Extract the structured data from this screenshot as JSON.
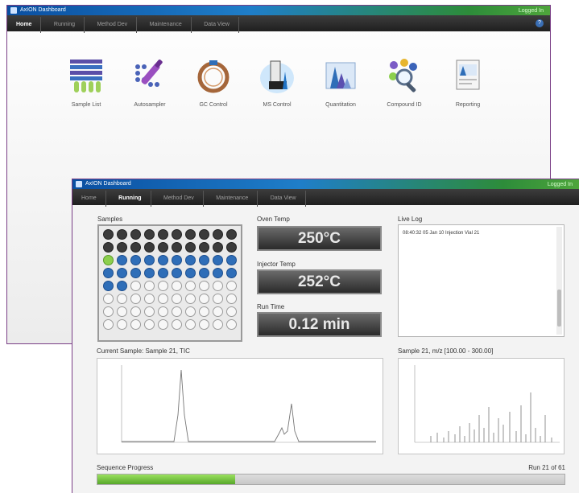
{
  "window_home": {
    "title": "AxION Dashboard",
    "status": "Logged In",
    "nav_tabs": [
      "Home",
      "Running",
      "Method Dev",
      "Maintenance",
      "Data View"
    ],
    "active_tab": "Home",
    "launchers": [
      {
        "label": "Sample List",
        "icon": "sample-list-icon"
      },
      {
        "label": "Autosampler",
        "icon": "autosampler-icon"
      },
      {
        "label": "GC Control",
        "icon": "gc-control-icon"
      },
      {
        "label": "MS Control",
        "icon": "ms-control-icon"
      },
      {
        "label": "Quantitation",
        "icon": "quantitation-icon"
      },
      {
        "label": "Compound ID",
        "icon": "compound-id-icon"
      },
      {
        "label": "Reporting",
        "icon": "reporting-icon"
      }
    ]
  },
  "window_running": {
    "title": "AxION Dashboard",
    "status": "Logged In",
    "nav_tabs": [
      "Home",
      "Running",
      "Method Dev",
      "Maintenance",
      "Data View"
    ],
    "active_tab": "Running",
    "samples": {
      "label": "Samples",
      "rows": 8,
      "cols": 10,
      "completed": 20,
      "current_index": 21,
      "queued_until": 42
    },
    "oven_temp": {
      "label": "Oven Temp",
      "value": "250°C"
    },
    "injector_temp": {
      "label": "Injector Temp",
      "value": "252°C"
    },
    "run_time": {
      "label": "Run Time",
      "value": "0.12 min"
    },
    "live_log": {
      "label": "Live Log",
      "entries": [
        "08:40:32  05 Jan 10   Injection  Vial 21"
      ]
    },
    "tic_plot": {
      "label": "Current Sample: Sample 21, TIC"
    },
    "mz_plot": {
      "label": "Sample 21, m/z [100.00 - 300.00]"
    },
    "sequence": {
      "label": "Sequence Progress",
      "status": "Run 21 of 61",
      "progress": 0.294
    }
  },
  "colors": {
    "accent": "#2f6eb8",
    "done_well": "#3b3b3b",
    "current_well": "#8ccf4d",
    "progress": "#6cc13a",
    "frame": "#7a3e86"
  }
}
